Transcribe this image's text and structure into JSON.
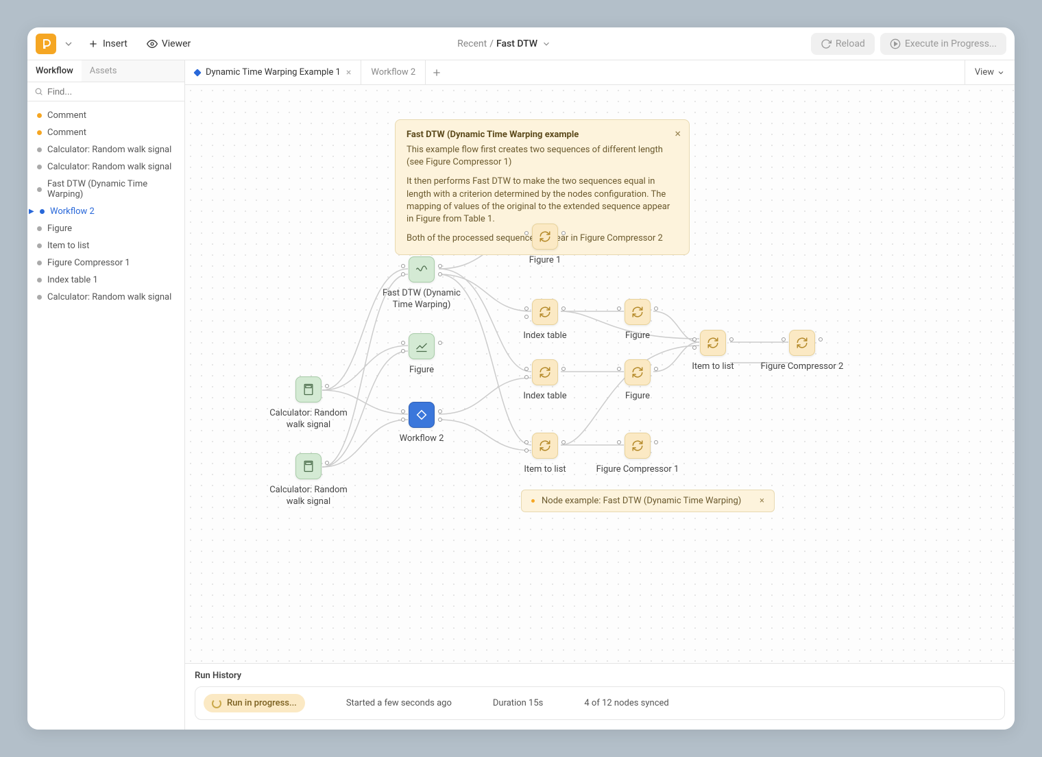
{
  "topbar": {
    "insert_label": "Insert",
    "viewer_label": "Viewer",
    "breadcrumb_parent": "Recent",
    "breadcrumb_sep": "/",
    "breadcrumb_current": "Fast DTW",
    "reload_label": "Reload",
    "execute_label": "Execute in Progress..."
  },
  "sidebar": {
    "tabs": {
      "workflow": "Workflow",
      "assets": "Assets"
    },
    "search_placeholder": "Find...",
    "items": [
      {
        "label": "Comment",
        "dot": "y"
      },
      {
        "label": "Comment",
        "dot": "y"
      },
      {
        "label": "Calculator: Random walk signal",
        "dot": "g"
      },
      {
        "label": "Calculator: Random walk signal",
        "dot": "g"
      },
      {
        "label": "Fast DTW (Dynamic Time Warping)",
        "dot": "g"
      },
      {
        "label": "Workflow 2",
        "dot": "b",
        "selected": true
      },
      {
        "label": "Figure",
        "dot": "g"
      },
      {
        "label": "Item to list",
        "dot": "g"
      },
      {
        "label": "Figure Compressor 1",
        "dot": "g"
      },
      {
        "label": "Index table 1",
        "dot": "g"
      },
      {
        "label": "Calculator: Random walk signal",
        "dot": "g"
      }
    ]
  },
  "tabs": {
    "t1": "Dynamic Time Warping Example 1",
    "t2": "Workflow 2",
    "view": "View"
  },
  "comment": {
    "title": "Fast DTW (Dynamic Time Warping example",
    "p1": "This example flow first creates two sequences of different length (see Figure Compressor 1)",
    "p2": "It then performs Fast DTW to make the two sequences equal in length with a criterion determined by the nodes configuration. The mapping of values of the original to the extended sequence appear in Figure from Table 1.",
    "p3": "Both of the processed sequences appear in Figure Compressor 2"
  },
  "nodes": {
    "calc1": "Calculator: Random walk signal",
    "calc2": "Calculator: Random walk signal",
    "fastdtw": "Fast DTW (Dynamic Time Warping)",
    "figure_top": "Figure",
    "workflow2": "Workflow 2",
    "figure1": "Figure 1",
    "index1": "Index table",
    "figure_m": "Figure",
    "index2": "Index table",
    "figure_b": "Figure",
    "item1": "Item to list",
    "figcomp1": "Figure Compressor 1",
    "item2": "Item to list",
    "figcomp2": "Figure Compressor 2"
  },
  "toast": {
    "text": "Node example: Fast DTW (Dynamic Time Warping)"
  },
  "run_history": {
    "title": "Run History",
    "status": "Run in progress...",
    "started": "Started a few seconds ago",
    "duration": "Duration 15s",
    "synced": "4 of 12 nodes synced"
  }
}
